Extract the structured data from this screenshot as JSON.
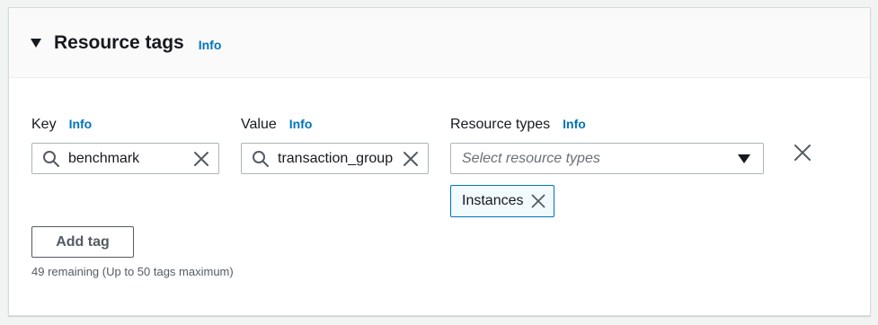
{
  "section": {
    "title": "Resource tags",
    "info_label": "Info",
    "expanded": true
  },
  "fields": {
    "key": {
      "label": "Key",
      "info_label": "Info",
      "value": "benchmark",
      "icon": "search-icon"
    },
    "value": {
      "label": "Value",
      "info_label": "Info",
      "value": "transaction_group",
      "icon": "search-icon"
    },
    "resource_types": {
      "label": "Resource types",
      "info_label": "Info",
      "placeholder": "Select resource types",
      "selected": [
        {
          "label": "Instances"
        }
      ]
    }
  },
  "add_tag_label": "Add tag",
  "remaining_text": "49 remaining (Up to 50 tags maximum)",
  "colors": {
    "link": "#0073bb",
    "text": "#16191f",
    "border": "#aab7b8",
    "token_border": "#0073bb",
    "token_bg": "#f1faff"
  }
}
